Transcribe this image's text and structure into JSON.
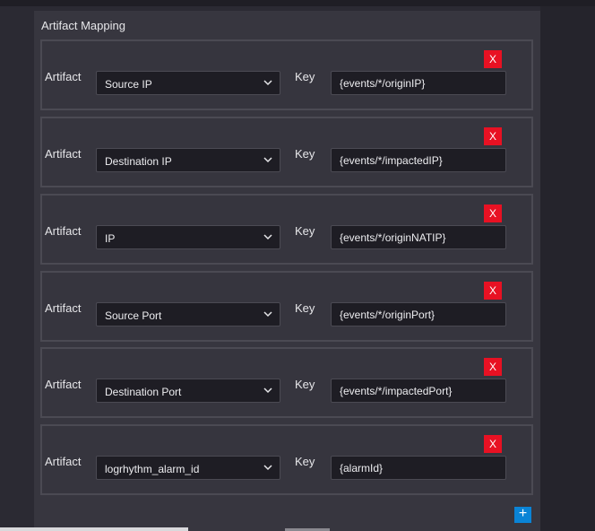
{
  "section": {
    "title": "Artifact Mapping"
  },
  "labels": {
    "artifact": "Artifact",
    "key": "Key"
  },
  "mappings": [
    {
      "artifact": "Source IP",
      "key": "{events/*/originIP}",
      "remove_label": "X"
    },
    {
      "artifact": "Destination IP",
      "key": "{events/*/impactedIP}",
      "remove_label": "X"
    },
    {
      "artifact": "IP",
      "key": "{events/*/originNATIP}",
      "remove_label": "X"
    },
    {
      "artifact": "Source Port",
      "key": "{events/*/originPort}",
      "remove_label": "X"
    },
    {
      "artifact": "Destination Port",
      "key": "{events/*/impactedPort}",
      "remove_label": "X"
    },
    {
      "artifact": "logrhythm_alarm_id",
      "key": "{alarmId}",
      "remove_label": "X"
    }
  ],
  "add_button": {
    "label": "+"
  },
  "colors": {
    "remove_button": "#e81123",
    "add_button": "#0a84d6",
    "panel": "#37363f",
    "input_bg": "#1e1d24"
  },
  "icons": {
    "select_caret": "chevron-down-icon",
    "remove": "close-icon",
    "add": "plus-icon"
  }
}
